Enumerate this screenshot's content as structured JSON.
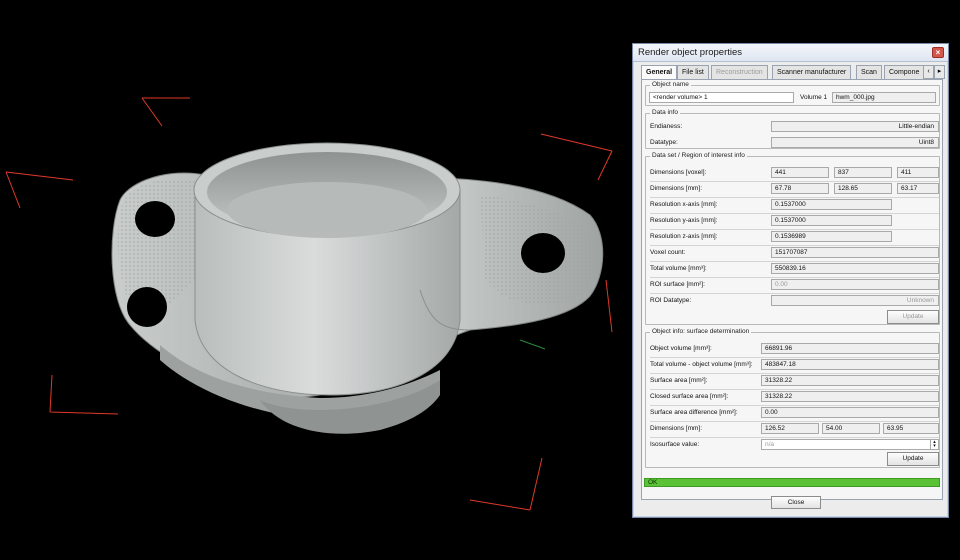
{
  "dialog": {
    "title": "Render object properties",
    "tabs": [
      "General",
      "File list",
      "Reconstruction",
      "Scanner manufacturer",
      "Scan",
      "Compone"
    ],
    "object_name": {
      "legend": "Object name",
      "name_value": "<render volume> 1",
      "volume_label": "Volume 1",
      "file_value": "hwm_000.jpg"
    },
    "data_info": {
      "legend": "Data info",
      "endianess_label": "Endianess:",
      "endianess_value": "Little-endian",
      "datatype_label": "Datatype:",
      "datatype_value": "Uint8"
    },
    "dataset": {
      "legend": "Data set / Region of interest info",
      "dims_voxel_label": "Dimensions [voxel]:",
      "dims_voxel": [
        "441",
        "837",
        "411"
      ],
      "dims_mm_label": "Dimensions [mm]:",
      "dims_mm": [
        "67.78",
        "128.65",
        "63.17"
      ],
      "res_x_label": "Resolution x-axis [mm]:",
      "res_x": "0.1537000",
      "res_y_label": "Resolution y-axis [mm]:",
      "res_y": "0.1537000",
      "res_z_label": "Resolution z-axis [mm]:",
      "res_z": "0.1536989",
      "voxel_count_label": "Voxel count:",
      "voxel_count": "151707087",
      "total_volume_label": "Total volume [mm³]:",
      "total_volume": "550839.16",
      "roi_surface_label": "ROI surface [mm²]:",
      "roi_surface": "0.00",
      "roi_datatype_label": "ROI Datatype:",
      "roi_datatype": "Unknown",
      "update_label": "Update"
    },
    "surface": {
      "legend": "Object info: surface determination",
      "object_volume_label": "Object volume [mm³]:",
      "object_volume": "66891.96",
      "total_minus_label": "Total volume - object volume [mm³]:",
      "total_minus": "483847.18",
      "surface_area_label": "Surface area [mm²]:",
      "surface_area": "31328.22",
      "closed_area_label": "Closed surface area [mm²]:",
      "closed_area": "31328.22",
      "area_diff_label": "Surface area difference [mm²]:",
      "area_diff": "0.00",
      "dims_label": "Dimensions [mm]:",
      "dims": [
        "126.52",
        "54.00",
        "63.95"
      ],
      "iso_label": "Isosurface value:",
      "iso_value": "n/a",
      "update_label": "Update"
    },
    "status": "OK",
    "close_label": "Close"
  }
}
